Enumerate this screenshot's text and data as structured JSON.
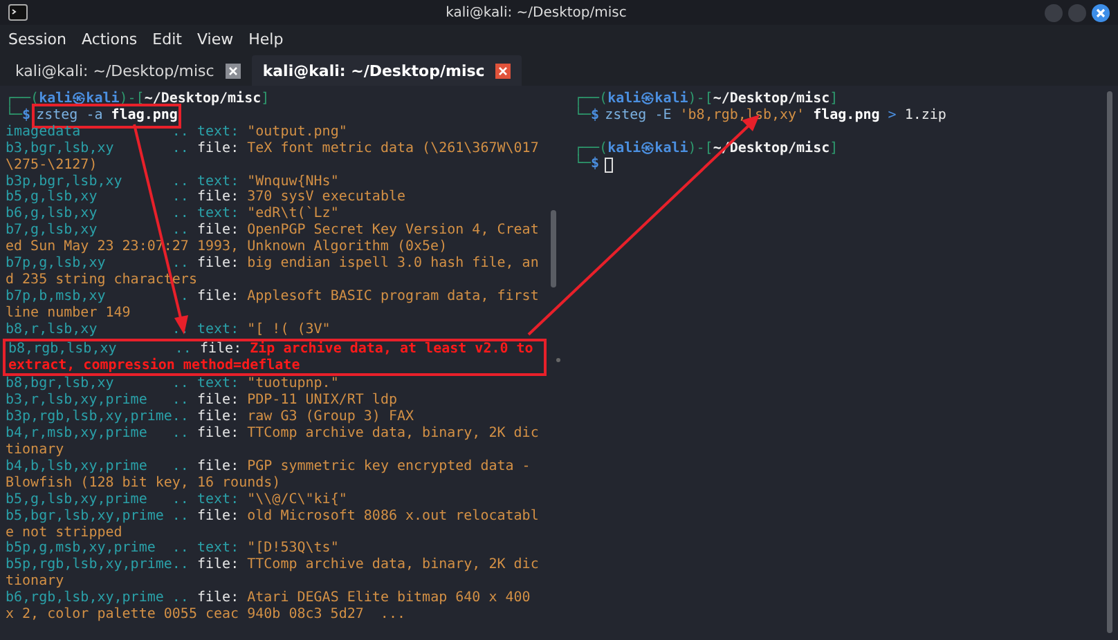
{
  "window": {
    "title": "kali@kali: ~/Desktop/misc"
  },
  "menu": [
    "Session",
    "Actions",
    "Edit",
    "View",
    "Help"
  ],
  "tabs": [
    {
      "label": "kali@kali: ~/Desktop/misc",
      "selected": false
    },
    {
      "label": "kali@kali: ~/Desktop/misc",
      "selected": true
    }
  ],
  "left_pane": {
    "prompt": [
      {
        "text": "┌──(",
        "kind": "frame"
      },
      {
        "text": "kali㉿kali",
        "kind": "user"
      },
      {
        "text": ")-[",
        "kind": "frame"
      },
      {
        "text": "~/Desktop/misc",
        "kind": "path"
      },
      {
        "text": "]",
        "kind": "frame"
      }
    ],
    "prompt_end": [
      {
        "text": "└─",
        "kind": "frame"
      },
      {
        "text": "$",
        "kind": "dollar"
      }
    ],
    "command": [
      {
        "text": "zsteg -a",
        "kind": "cmd"
      },
      {
        "text": "flag.png",
        "kind": "arg"
      }
    ],
    "command_highlighted": true,
    "output": [
      {
        "key": "imagedata",
        "sep": "..",
        "type": "text:",
        "kind": "text",
        "value": "\"output.png\"",
        "highlighted": false
      },
      {
        "key": "b3,bgr,lsb,xy",
        "sep": "..",
        "type": "file:",
        "kind": "file",
        "value": "TeX font metric data (\\261\\367W\\017\\275-\\2127)",
        "highlighted": false
      },
      {
        "key": "b3p,bgr,lsb,xy",
        "sep": "..",
        "type": "text:",
        "kind": "text",
        "value": "\"Wnquw{NHs\"",
        "highlighted": false
      },
      {
        "key": "b5,g,lsb,xy",
        "sep": "..",
        "type": "file:",
        "kind": "file",
        "value": "370 sysV executable",
        "highlighted": false
      },
      {
        "key": "b6,g,lsb,xy",
        "sep": "..",
        "type": "text:",
        "kind": "text",
        "value": "\"edR\\t(`Lz\"",
        "highlighted": false
      },
      {
        "key": "b7,g,lsb,xy",
        "sep": "..",
        "type": "file:",
        "kind": "file",
        "value": "OpenPGP Secret Key Version 4, Created Sun May 23 23:07:27 1993, Unknown Algorithm (0x5e)",
        "highlighted": false
      },
      {
        "key": "b7p,g,lsb,xy",
        "sep": "..",
        "type": "file:",
        "kind": "file",
        "value": "big endian ispell 3.0 hash file, and 235 string characters",
        "highlighted": false
      },
      {
        "key": "b7p,b,msb,xy",
        "sep": "..",
        "type": "file:",
        "kind": "file",
        "value": "Applesoft BASIC program data, first line number 149",
        "highlighted": false
      },
      {
        "key": "b8,r,lsb,xy",
        "sep": "..",
        "type": "text:",
        "kind": "text",
        "value": "\"[ !( (3V\"",
        "highlighted": false
      },
      {
        "key": "b8,rgb,lsb,xy",
        "sep": "..",
        "type": "file:",
        "kind": "file",
        "value": "Zip archive data, at least v2.0 to extract, compression method=deflate",
        "highlighted": true
      },
      {
        "key": "b8,bgr,lsb,xy",
        "sep": "..",
        "type": "text:",
        "kind": "text",
        "value": "\"tuotupnp.\"",
        "highlighted": false
      },
      {
        "key": "b3,r,lsb,xy,prime",
        "sep": "..",
        "type": "file:",
        "kind": "file",
        "value": "PDP-11 UNIX/RT ldp",
        "highlighted": false
      },
      {
        "key": "b3p,rgb,lsb,xy,prime",
        "sep": "..",
        "type": "file:",
        "kind": "file",
        "value": "raw G3 (Group 3) FAX",
        "highlighted": false
      },
      {
        "key": "b4,r,msb,xy,prime",
        "sep": "..",
        "type": "file:",
        "kind": "file",
        "value": "TTComp archive data, binary, 2K dictionary",
        "highlighted": false
      },
      {
        "key": "b4,b,lsb,xy,prime",
        "sep": "..",
        "type": "file:",
        "kind": "file",
        "value": "PGP symmetric key encrypted data - Blowfish (128 bit key, 16 rounds)",
        "highlighted": false
      },
      {
        "key": "b5,g,lsb,xy,prime",
        "sep": "..",
        "type": "text:",
        "kind": "text",
        "value": "\"\\\\@/C\\\"ki{\"",
        "highlighted": false
      },
      {
        "key": "b5,bgr,lsb,xy,prime",
        "sep": "..",
        "type": "file:",
        "kind": "file",
        "value": "old Microsoft 8086 x.out relocatable not stripped",
        "highlighted": false
      },
      {
        "key": "b5p,g,msb,xy,prime",
        "sep": "..",
        "type": "text:",
        "kind": "text",
        "value": "\"[D!53Q\\ts\"",
        "highlighted": false
      },
      {
        "key": "b5p,rgb,lsb,xy,prime",
        "sep": "..",
        "type": "file:",
        "kind": "file",
        "value": "TTComp archive data, binary, 2K dictionary",
        "highlighted": false
      },
      {
        "key": "b6,rgb,lsb,xy,prime",
        "sep": "..",
        "type": "file:",
        "kind": "file",
        "value": "Atari DEGAS Elite bitmap 640 x 400 x 2, color palette 0055 ceac 940b 08c3 5d27  ...",
        "highlighted": false
      }
    ]
  },
  "right_pane": {
    "blocks": [
      {
        "prompt": [
          {
            "text": "┌──(",
            "kind": "frame"
          },
          {
            "text": "kali㉿kali",
            "kind": "user"
          },
          {
            "text": ")-[",
            "kind": "frame"
          },
          {
            "text": "~/Desktop/misc",
            "kind": "path"
          },
          {
            "text": "]",
            "kind": "frame"
          }
        ],
        "prompt_end": [
          {
            "text": "└─",
            "kind": "frame"
          },
          {
            "text": "$",
            "kind": "dollar"
          }
        ],
        "command": [
          {
            "text": "zsteg -E",
            "kind": "cmd"
          },
          {
            "text": "'b8,rgb,lsb,xy'",
            "kind": "string"
          },
          {
            "text": "flag.png",
            "kind": "arg"
          },
          {
            "text": ">",
            "kind": "op"
          },
          {
            "text": "1.zip",
            "kind": "plain"
          }
        ]
      },
      {
        "prompt": [
          {
            "text": "┌──(",
            "kind": "frame"
          },
          {
            "text": "kali㉿kali",
            "kind": "user"
          },
          {
            "text": ")-[",
            "kind": "frame"
          },
          {
            "text": "~/Desktop/misc",
            "kind": "path"
          },
          {
            "text": "]",
            "kind": "frame"
          }
        ],
        "prompt_end": [
          {
            "text": "└─",
            "kind": "frame"
          },
          {
            "text": "$",
            "kind": "dollar"
          }
        ],
        "cursor": true
      }
    ]
  }
}
